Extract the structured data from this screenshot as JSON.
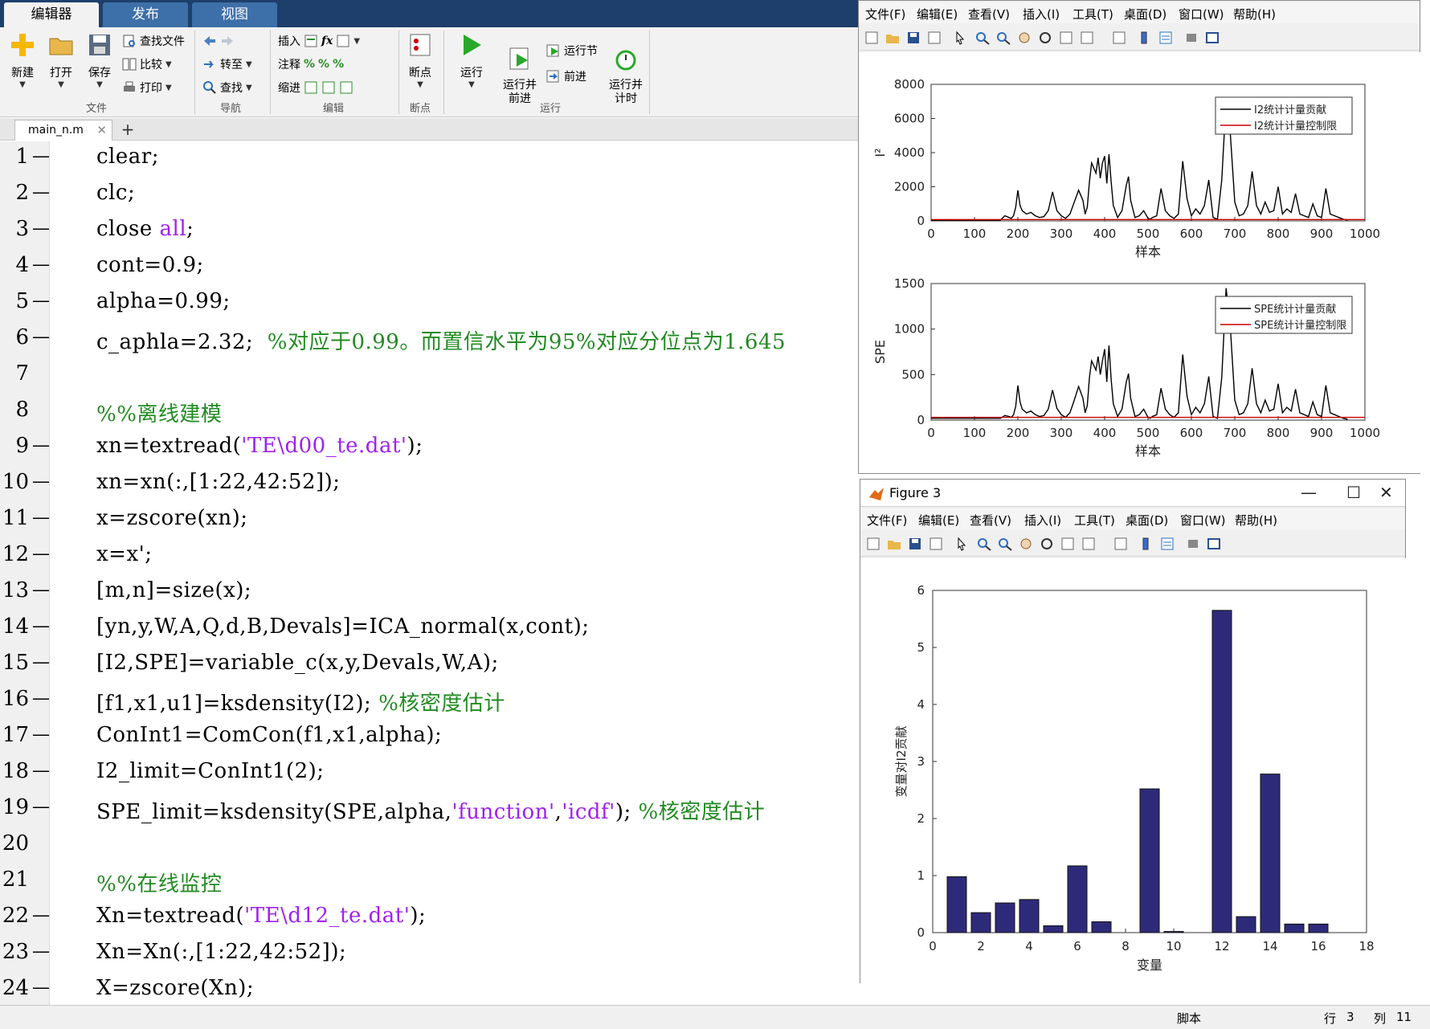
{
  "ribbon": {
    "tabs": [
      "编辑器",
      "发布",
      "视图"
    ],
    "file_section": {
      "new": "新建",
      "open": "打开",
      "save": "保存",
      "find_files": "查找文件",
      "compare": "比较",
      "print": "打印",
      "label": "文件"
    },
    "nav_section": {
      "goto": "转至",
      "find": "查找",
      "label": "导航"
    },
    "edit_section": {
      "insert": "插入",
      "comment": "注释",
      "indent": "缩进",
      "label": "编辑"
    },
    "breakpoint_section": {
      "breakpoints": "断点",
      "label": "断点"
    },
    "run_section": {
      "run": "运行",
      "run_advance": "运行并\n前进",
      "run_section": "运行节",
      "advance": "前进",
      "run_time": "运行并\n计时",
      "label": "运行"
    }
  },
  "file_tab": {
    "name": "main_n.m",
    "close": "✕",
    "add": "+"
  },
  "code_lines": [
    {
      "n": "1",
      "dash": "—",
      "parts": [
        {
          "t": "clear;"
        }
      ]
    },
    {
      "n": "2",
      "dash": "—",
      "parts": [
        {
          "t": "clc;"
        }
      ]
    },
    {
      "n": "3",
      "dash": "—",
      "parts": [
        {
          "t": "close "
        },
        {
          "t": "all",
          "c": "kw"
        },
        {
          "t": ";"
        }
      ]
    },
    {
      "n": "4",
      "dash": "—",
      "parts": [
        {
          "t": "cont=0.9;"
        }
      ]
    },
    {
      "n": "5",
      "dash": "—",
      "parts": [
        {
          "t": "alpha=0.99;"
        }
      ]
    },
    {
      "n": "6",
      "dash": "—",
      "parts": [
        {
          "t": "c_aphla=2.32;  "
        },
        {
          "t": "%对应于0.99。而置信水平为95%对应分位点为1.645",
          "c": "cmt"
        }
      ]
    },
    {
      "n": "7",
      "dash": "",
      "parts": []
    },
    {
      "n": "8",
      "dash": "",
      "parts": [
        {
          "t": "%%离线建模",
          "c": "cmt"
        }
      ]
    },
    {
      "n": "9",
      "dash": "—",
      "parts": [
        {
          "t": "xn=textread("
        },
        {
          "t": "'TE\\d00_te.dat'",
          "c": "str"
        },
        {
          "t": ");"
        }
      ]
    },
    {
      "n": "10",
      "dash": "—",
      "parts": [
        {
          "t": "xn=xn(:,[1:22,42:52]);"
        }
      ]
    },
    {
      "n": "11",
      "dash": "—",
      "parts": [
        {
          "t": "x=zscore(xn);"
        }
      ]
    },
    {
      "n": "12",
      "dash": "—",
      "parts": [
        {
          "t": "x=x';"
        }
      ]
    },
    {
      "n": "13",
      "dash": "—",
      "parts": [
        {
          "t": "[m,n]=size(x);"
        }
      ]
    },
    {
      "n": "14",
      "dash": "—",
      "parts": [
        {
          "t": "[yn,y,W,A,Q,d,B,Devals]=ICA_normal(x,cont);"
        }
      ]
    },
    {
      "n": "15",
      "dash": "—",
      "parts": [
        {
          "t": "[I2,SPE]=variable_c(x,y,Devals,W,A);"
        }
      ]
    },
    {
      "n": "16",
      "dash": "—",
      "parts": [
        {
          "t": "[f1,x1,u1]=ksdensity(I2); "
        },
        {
          "t": "%核密度估计",
          "c": "cmt"
        }
      ]
    },
    {
      "n": "17",
      "dash": "—",
      "parts": [
        {
          "t": "ConInt1=ComCon(f1,x1,alpha);"
        }
      ]
    },
    {
      "n": "18",
      "dash": "—",
      "parts": [
        {
          "t": "I2_limit=ConInt1(2);"
        }
      ]
    },
    {
      "n": "19",
      "dash": "—",
      "parts": [
        {
          "t": "SPE_limit=ksdensity(SPE,alpha,"
        },
        {
          "t": "'function'",
          "c": "str"
        },
        {
          "t": ","
        },
        {
          "t": "'icdf'",
          "c": "str"
        },
        {
          "t": "); "
        },
        {
          "t": "%核密度估计",
          "c": "cmt"
        }
      ]
    },
    {
      "n": "20",
      "dash": "",
      "parts": []
    },
    {
      "n": "21",
      "dash": "",
      "parts": [
        {
          "t": "%%在线监控",
          "c": "cmt"
        }
      ]
    },
    {
      "n": "22",
      "dash": "—",
      "parts": [
        {
          "t": "Xn=textread("
        },
        {
          "t": "'TE\\d12_te.dat'",
          "c": "str"
        },
        {
          "t": ");"
        }
      ]
    },
    {
      "n": "23",
      "dash": "—",
      "parts": [
        {
          "t": "Xn=Xn(:,[1:22,42:52]);"
        }
      ]
    },
    {
      "n": "24",
      "dash": "—",
      "parts": [
        {
          "t": "X=zscore(Xn);"
        }
      ]
    }
  ],
  "figure_menu": [
    "文件(F)",
    "编辑(E)",
    "查看(V)",
    "插入(I)",
    "工具(T)",
    "桌面(D)",
    "窗口(W)",
    "帮助(H)"
  ],
  "figure3": {
    "title": "Figure 3",
    "minimize": "—",
    "maximize": "☐",
    "close": "✕"
  },
  "statusbar": {
    "mode": "脚本",
    "row_label": "行",
    "row": "3",
    "col_label": "列",
    "col": "11"
  },
  "colors": {
    "accent": "#1e3f6b",
    "bar": "#2e2a7a",
    "limit_line": "#cc0000",
    "comment": "#228b22",
    "string": "#a020f0"
  },
  "chart_data": [
    {
      "type": "line",
      "title": "",
      "xlabel": "样本",
      "ylabel": "I²",
      "xlim": [
        0,
        1000
      ],
      "ylim": [
        0,
        8000
      ],
      "xticks": [
        "0",
        "100",
        "200",
        "300",
        "400",
        "500",
        "600",
        "700",
        "800",
        "900",
        "1000"
      ],
      "yticks": [
        "0",
        "2000",
        "4000",
        "6000",
        "8000"
      ],
      "legend": [
        "I2统计计量贡献",
        "I2统计计量控制限"
      ],
      "legend_position": "top-right",
      "series": [
        {
          "name": "I2统计计量贡献",
          "color": "#000000",
          "x": [
            0,
            160,
            170,
            180,
            185,
            190,
            195,
            200,
            205,
            210,
            220,
            230,
            240,
            250,
            260,
            270,
            280,
            290,
            300,
            310,
            320,
            330,
            340,
            350,
            355,
            360,
            365,
            370,
            380,
            385,
            390,
            395,
            400,
            405,
            410,
            415,
            420,
            430,
            440,
            450,
            455,
            460,
            470,
            480,
            490,
            500,
            505,
            510,
            520,
            530,
            540,
            550,
            560,
            570,
            580,
            590,
            600,
            610,
            620,
            630,
            640,
            650,
            660,
            670,
            680,
            690,
            700,
            710,
            720,
            730,
            740,
            750,
            760,
            770,
            780,
            790,
            800,
            810,
            820,
            830,
            840,
            850,
            860,
            870,
            880,
            890,
            900,
            910,
            920,
            930,
            940,
            950,
            960
          ],
          "y": [
            50,
            50,
            300,
            200,
            150,
            300,
            800,
            1800,
            900,
            600,
            400,
            500,
            300,
            200,
            250,
            600,
            1700,
            600,
            300,
            150,
            400,
            1100,
            1800,
            1200,
            400,
            800,
            2300,
            3400,
            2800,
            3700,
            2500,
            3400,
            3800,
            2200,
            3900,
            2300,
            900,
            200,
            600,
            2100,
            2600,
            1200,
            200,
            300,
            600,
            150,
            100,
            200,
            300,
            1900,
            600,
            300,
            150,
            400,
            3500,
            1300,
            300,
            700,
            400,
            900,
            2400,
            200,
            100,
            2400,
            7100,
            5000,
            1100,
            300,
            400,
            900,
            2900,
            900,
            400,
            1100,
            500,
            600,
            2000,
            400,
            700,
            500,
            1600,
            400,
            300,
            200,
            1000,
            300,
            200,
            1900,
            400,
            300,
            200,
            100,
            50
          ]
        },
        {
          "name": "I2统计计量控制限",
          "color": "#cc0000",
          "x": [
            0,
            1000
          ],
          "y": [
            80,
            80
          ]
        }
      ]
    },
    {
      "type": "line",
      "title": "",
      "xlabel": "样本",
      "ylabel": "SPE",
      "xlim": [
        0,
        1000
      ],
      "ylim": [
        0,
        1500
      ],
      "xticks": [
        "0",
        "100",
        "200",
        "300",
        "400",
        "500",
        "600",
        "700",
        "800",
        "900",
        "1000"
      ],
      "yticks": [
        "0",
        "500",
        "1000",
        "1500"
      ],
      "legend": [
        "SPE统计计量贡献",
        "SPE统计计量控制限"
      ],
      "legend_position": "top-right",
      "series": [
        {
          "name": "SPE统计计量贡献",
          "color": "#000000",
          "x": [
            0,
            160,
            170,
            180,
            185,
            190,
            195,
            200,
            205,
            210,
            220,
            230,
            240,
            250,
            260,
            270,
            280,
            290,
            300,
            310,
            320,
            330,
            340,
            350,
            355,
            360,
            365,
            370,
            380,
            385,
            390,
            395,
            400,
            405,
            410,
            415,
            420,
            430,
            440,
            450,
            455,
            460,
            470,
            480,
            490,
            500,
            505,
            510,
            520,
            530,
            540,
            550,
            560,
            570,
            580,
            590,
            600,
            610,
            620,
            630,
            640,
            650,
            660,
            670,
            680,
            690,
            700,
            710,
            720,
            730,
            740,
            750,
            760,
            770,
            780,
            790,
            800,
            810,
            820,
            830,
            840,
            850,
            860,
            870,
            880,
            890,
            900,
            910,
            920,
            930,
            940,
            950,
            960
          ],
          "y": [
            20,
            20,
            50,
            40,
            30,
            60,
            150,
            380,
            200,
            120,
            80,
            100,
            60,
            40,
            50,
            120,
            330,
            130,
            60,
            30,
            80,
            220,
            370,
            240,
            80,
            160,
            470,
            650,
            550,
            700,
            500,
            650,
            780,
            420,
            820,
            450,
            180,
            40,
            120,
            420,
            510,
            240,
            40,
            60,
            120,
            30,
            20,
            40,
            60,
            350,
            120,
            60,
            30,
            80,
            720,
            260,
            60,
            140,
            80,
            180,
            480,
            40,
            20,
            470,
            1450,
            1000,
            220,
            60,
            80,
            180,
            570,
            180,
            80,
            220,
            100,
            120,
            400,
            80,
            140,
            100,
            340,
            80,
            60,
            40,
            200,
            60,
            40,
            380,
            80,
            60,
            40,
            20,
            10
          ]
        },
        {
          "name": "SPE统计计量控制限",
          "color": "#cc0000",
          "x": [
            0,
            1000
          ],
          "y": [
            30,
            30
          ]
        }
      ]
    },
    {
      "type": "bar",
      "title": "",
      "xlabel": "变量",
      "ylabel": "变量对I2贡献",
      "xlim": [
        0,
        18
      ],
      "ylim": [
        0,
        6
      ],
      "xticks": [
        "0",
        "2",
        "4",
        "6",
        "8",
        "10",
        "12",
        "14",
        "16",
        "18"
      ],
      "yticks": [
        "0",
        "1",
        "2",
        "3",
        "4",
        "5",
        "6"
      ],
      "categories": [
        1,
        2,
        3,
        4,
        5,
        6,
        7,
        8,
        9,
        10,
        11,
        12,
        13,
        14,
        15,
        16
      ],
      "values": [
        0.98,
        0.35,
        0.52,
        0.58,
        0.12,
        1.17,
        0.19,
        0.0,
        2.52,
        0.02,
        0.0,
        5.65,
        0.28,
        2.78,
        0.15,
        0.15
      ],
      "color": "#2e2a7a"
    }
  ]
}
